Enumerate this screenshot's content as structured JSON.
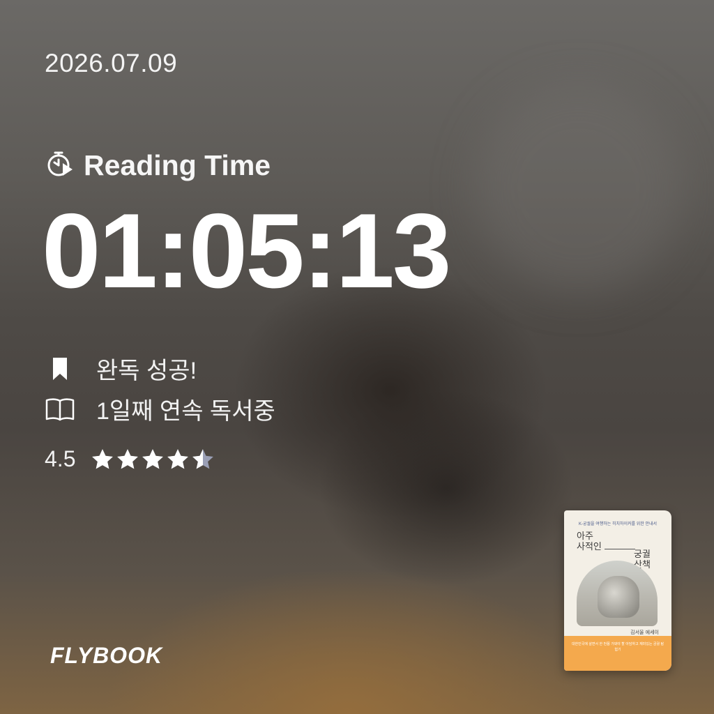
{
  "date": "2026.07.09",
  "reading_time": {
    "label": "Reading Time",
    "icon": "stopwatch-play-icon",
    "value": "01:05:13"
  },
  "status": [
    {
      "icon": "bookmark-icon",
      "text": "완독 성공!"
    },
    {
      "icon": "open-book-icon",
      "text": "1일째 연속 독서중"
    }
  ],
  "rating": {
    "value_text": "4.5",
    "value": 4.5,
    "max": 5
  },
  "brand": "FLYBOOK",
  "book": {
    "tagline": "K-궁궐을 여행하는 히치하이커를 위한 안내서",
    "title_a": [
      "아주",
      "사적인"
    ],
    "title_b": [
      "궁궐",
      "산책"
    ],
    "author": "김서울 에세이",
    "band_text": "대한민국에 살면서 한 번쯤 가봐야 할 아담하고 재미있는 궁궐 탐험기"
  },
  "colors": {
    "text": "#ffffff",
    "star_filled": "#ffffff",
    "star_empty": "#9a9fb5",
    "book_band": "#f4a94d"
  }
}
